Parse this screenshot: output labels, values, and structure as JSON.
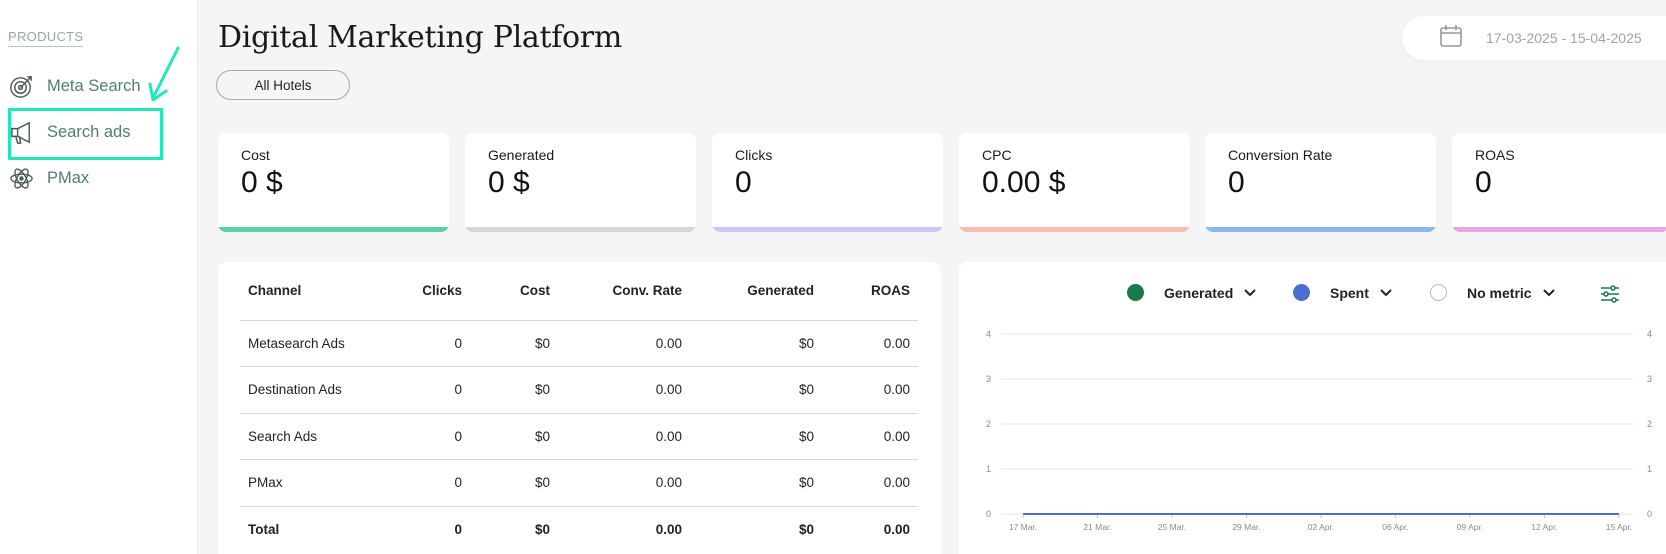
{
  "sidebar": {
    "heading": "PRODUCTS",
    "items": [
      {
        "label": "Meta Search",
        "icon": "target-icon"
      },
      {
        "label": "Search ads",
        "icon": "megaphone-icon"
      },
      {
        "label": "PMax",
        "icon": "atom-icon"
      }
    ]
  },
  "header": {
    "title": "Digital Marketing Platform",
    "hotel_filter": "All Hotels",
    "date_range": "17-03-2025 - 15-04-2025"
  },
  "kpis": [
    {
      "label": "Cost",
      "value": "0 $",
      "color": "#5cd2a0"
    },
    {
      "label": "Generated",
      "value": "0 $",
      "color": "#d6d6d6"
    },
    {
      "label": "Clicks",
      "value": "0",
      "color": "#c9c9f6"
    },
    {
      "label": "CPC",
      "value": "0.00 $",
      "color": "#f6bcb4"
    },
    {
      "label": "Conversion Rate",
      "value": "0",
      "color": "#8bb8f3"
    },
    {
      "label": "ROAS",
      "value": "0",
      "color": "#eaa6e6"
    }
  ],
  "table": {
    "headers": [
      "Channel",
      "Clicks",
      "Cost",
      "Conv. Rate",
      "Generated",
      "ROAS"
    ],
    "rows": [
      [
        "Metasearch Ads",
        "0",
        "$0",
        "0.00",
        "$0",
        "0.00"
      ],
      [
        "Destination Ads",
        "0",
        "$0",
        "0.00",
        "$0",
        "0.00"
      ],
      [
        "Search Ads",
        "0",
        "$0",
        "0.00",
        "$0",
        "0.00"
      ],
      [
        "PMax",
        "0",
        "$0",
        "0.00",
        "$0",
        "0.00"
      ],
      [
        "Total",
        "0",
        "$0",
        "0.00",
        "$0",
        "0.00"
      ]
    ]
  },
  "chart_legend": [
    {
      "label": "Generated",
      "color": "#1a7a4f",
      "filled": true
    },
    {
      "label": "Spent",
      "color": "#4b6fcf",
      "filled": true
    },
    {
      "label": "No metric",
      "color": "#ffffff",
      "filled": false
    }
  ],
  "chart_data": {
    "type": "line",
    "categories": [
      "17 Mar.",
      "21 Mar.",
      "25 Mar.",
      "29 Mar.",
      "02 Apr.",
      "06 Apr.",
      "09 Apr.",
      "12 Apr.",
      "15 Apr."
    ],
    "series": [
      {
        "name": "Generated",
        "values": [
          0,
          0,
          0,
          0,
          0,
          0,
          0,
          0,
          0
        ],
        "color": "#1a7a4f"
      },
      {
        "name": "Spent",
        "values": [
          0,
          0,
          0,
          0,
          0,
          0,
          0,
          0,
          0
        ],
        "color": "#4b6fcf"
      }
    ],
    "y_ticks": [
      "0",
      "1",
      "2",
      "3",
      "4"
    ],
    "y_ticks_right": [
      "0",
      "1",
      "2",
      "3",
      "4"
    ],
    "ylim": [
      0,
      4
    ],
    "grid": true
  }
}
